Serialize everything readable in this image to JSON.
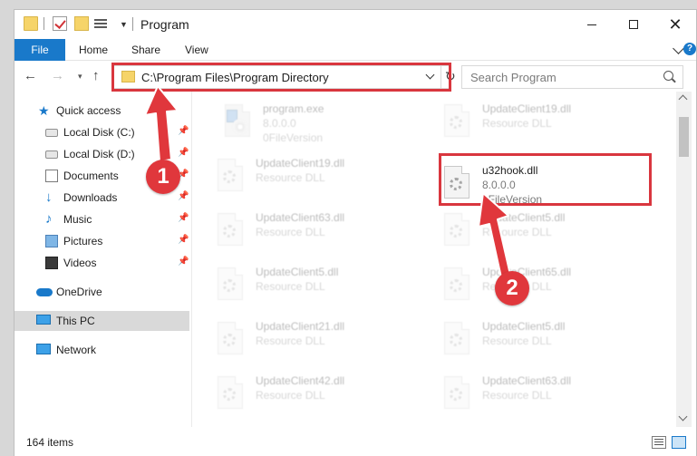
{
  "window": {
    "title": "Program",
    "controls": {
      "minimize": "",
      "maximize": "",
      "close": "✕"
    }
  },
  "ribbon": {
    "tabs": [
      {
        "label": "File"
      },
      {
        "label": "Home"
      },
      {
        "label": "Share"
      },
      {
        "label": "View"
      }
    ],
    "help": "?"
  },
  "navbar": {
    "back": "←",
    "forward": "→",
    "recent": "▾",
    "up": "↑",
    "address": "C:\\Program Files\\Program Directory",
    "refresh": "↻",
    "search_placeholder": "Search Program"
  },
  "sidebar": {
    "items": [
      {
        "label": "Quick access",
        "icon": "star-icon"
      },
      {
        "label": "Local Disk (C:)",
        "icon": "disk-icon",
        "pinned": true
      },
      {
        "label": "Local Disk (D:)",
        "icon": "disk-icon",
        "pinned": true
      },
      {
        "label": "Documents",
        "icon": "documents-icon",
        "pinned": true
      },
      {
        "label": "Downloads",
        "icon": "downloads-icon",
        "pinned": true
      },
      {
        "label": "Music",
        "icon": "music-icon",
        "pinned": true
      },
      {
        "label": "Pictures",
        "icon": "pictures-icon",
        "pinned": true
      },
      {
        "label": "Videos",
        "icon": "videos-icon",
        "pinned": true
      },
      {
        "label": "OneDrive",
        "icon": "onedrive-icon"
      },
      {
        "label": "This PC",
        "icon": "pc-icon",
        "selected": true
      },
      {
        "label": "Network",
        "icon": "network-icon"
      }
    ],
    "pin_glyph": "📌"
  },
  "files": [
    {
      "name": "program.exe",
      "line2": "8.0.0.0",
      "line3": "0FileVersion",
      "type": "exe"
    },
    {
      "name": "UpdateClient19.dll",
      "line2": "Resource DLL"
    },
    {
      "name": "UpdateClient19.dll",
      "line2": "Resource DLL"
    },
    {
      "name": "u32hook.dll",
      "line2": "8.0.0.0",
      "line3": "0FileVersion",
      "highlighted": true
    },
    {
      "name": "UpdateClient63.dll",
      "line2": "Resource DLL"
    },
    {
      "name": "UpdateClient5.dll",
      "line2": "Resource DLL"
    },
    {
      "name": "UpdateClient5.dll",
      "line2": "Resource DLL"
    },
    {
      "name": "UpdateClient65.dll",
      "line2": "Resource DLL"
    },
    {
      "name": "UpdateClient21.dll",
      "line2": "Resource DLL"
    },
    {
      "name": "UpdateClient5.dll",
      "line2": "Resource DLL"
    },
    {
      "name": "UpdateClient42.dll",
      "line2": "Resource DLL"
    },
    {
      "name": "UpdateClient63.dll",
      "line2": "Resource DLL"
    }
  ],
  "status": {
    "item_count": "164 items"
  },
  "annotations": {
    "badge1": "1",
    "badge2": "2",
    "accent": "#e0373c"
  }
}
